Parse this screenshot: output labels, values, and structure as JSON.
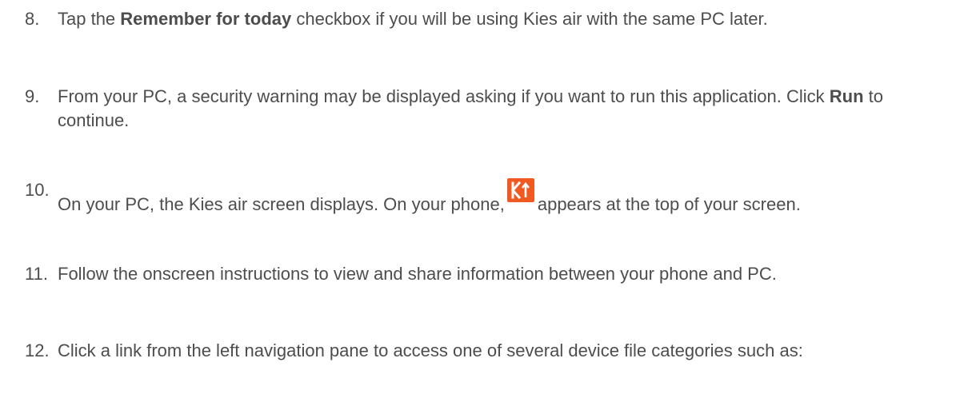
{
  "steps": [
    {
      "number": "8.",
      "before": "Tap the ",
      "bold": "Remember for today",
      "after": " checkbox if you will be using Kies air with the same PC later."
    },
    {
      "number": "9.",
      "before": "From your PC, a security warning may be displayed asking if you want to run this application. Click ",
      "bold": "Run",
      "after": " to continue."
    },
    {
      "number": "10.",
      "before": "On your PC, the Kies air screen displays. On your phone,",
      "icon": "kies-air-icon",
      "after": "appears at the top of your screen."
    },
    {
      "number": "11.",
      "text": "Follow the onscreen instructions to view and share information between your phone and PC."
    },
    {
      "number": "12.",
      "text": "Click a link from the left navigation pane to access one of several device file categories such as:"
    }
  ],
  "icon_colors": {
    "kies_bg": "#f05a22",
    "kies_fg": "#ffffff"
  },
  "text_color": "#4d4d4d"
}
